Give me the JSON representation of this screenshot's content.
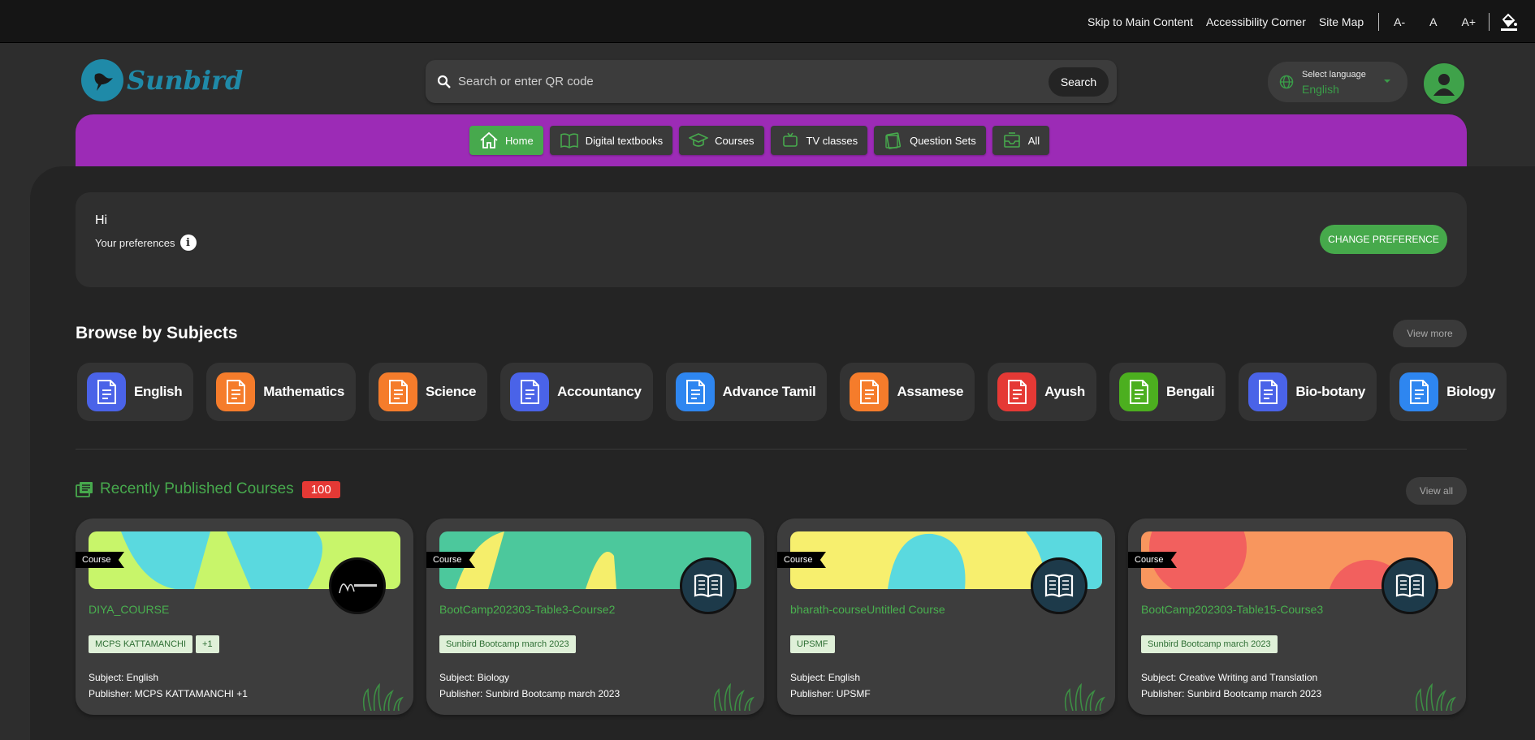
{
  "topbar": {
    "skip": "Skip to Main Content",
    "accessibility": "Accessibility Corner",
    "sitemap": "Site Map",
    "font_decrease": "A-",
    "font_normal": "A",
    "font_increase": "A+"
  },
  "logo": {
    "text": "Sunbird"
  },
  "search": {
    "placeholder": "Search or enter QR code",
    "button": "Search"
  },
  "language": {
    "label": "Select language",
    "value": "English"
  },
  "nav": [
    {
      "label": "Home",
      "icon": "home-icon",
      "active": true
    },
    {
      "label": "Digital textbooks",
      "icon": "book-icon",
      "active": false
    },
    {
      "label": "Courses",
      "icon": "graduation-cap-icon",
      "active": false
    },
    {
      "label": "TV classes",
      "icon": "tv-icon",
      "active": false
    },
    {
      "label": "Question Sets",
      "icon": "question-sets-icon",
      "active": false
    },
    {
      "label": "All",
      "icon": "inbox-icon",
      "active": false
    }
  ],
  "preferences": {
    "greeting": "Hi",
    "label": "Your preferences",
    "button": "CHANGE PREFERENCE"
  },
  "subjects_section": {
    "title": "Browse by Subjects",
    "view_more": "View more",
    "items": [
      {
        "name": "English",
        "color": "#4a63e8"
      },
      {
        "name": "Mathematics",
        "color": "#f57c2b"
      },
      {
        "name": "Science",
        "color": "#f57c2b"
      },
      {
        "name": "Accountancy",
        "color": "#4a63e8"
      },
      {
        "name": "Advance Tamil",
        "color": "#2e86f0"
      },
      {
        "name": "Assamese",
        "color": "#f57c2b"
      },
      {
        "name": "Ayush",
        "color": "#e53935"
      },
      {
        "name": "Bengali",
        "color": "#4caf1f"
      },
      {
        "name": "Bio-botany",
        "color": "#4a63e8"
      },
      {
        "name": "Biology",
        "color": "#2e86f0"
      }
    ]
  },
  "recent": {
    "title": "Recently Published Courses",
    "count": "100",
    "view_all": "View all",
    "cards": [
      {
        "badge": "Course",
        "title": "DIYA_COURSE",
        "tags": [
          "MCPS KATTAMANCHI",
          "+1"
        ],
        "subject": "Subject: English",
        "publisher": "Publisher: MCPS KATTAMANCHI +1",
        "banner": "lime-cyan",
        "logo": "brand-logo"
      },
      {
        "badge": "Course",
        "title": "BootCamp202303-Table3-Course2",
        "tags": [
          "Sunbird Bootcamp march 2023"
        ],
        "subject": "Subject: Biology",
        "publisher": "Publisher: Sunbird Bootcamp march 2023",
        "banner": "green-yellow",
        "logo": "book-icon"
      },
      {
        "badge": "Course",
        "title": "bharath-courseUntitled Course",
        "tags": [
          "UPSMF"
        ],
        "subject": "Subject: English",
        "publisher": "Publisher: UPSMF",
        "banner": "yellow-cyan",
        "logo": "book-icon"
      },
      {
        "badge": "Course",
        "title": "BootCamp202303-Table15-Course3",
        "tags": [
          "Sunbird Bootcamp march 2023"
        ],
        "subject": "Subject: Creative Writing and Translation",
        "publisher": "Publisher: Sunbird Bootcamp march 2023",
        "banner": "orange-red",
        "logo": "book-icon"
      }
    ]
  },
  "colors": {
    "accent_green": "#47a94d",
    "nav_purple": "#9c2bb6",
    "brand_teal": "#1f8aa8",
    "badge_red": "#e53935"
  }
}
